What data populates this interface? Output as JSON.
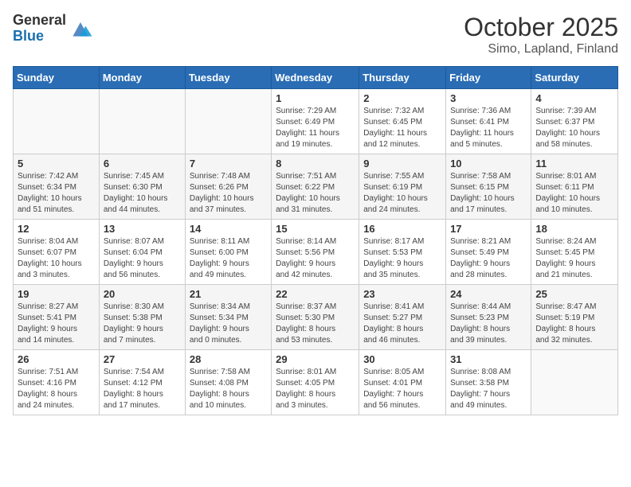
{
  "header": {
    "logo_general": "General",
    "logo_blue": "Blue",
    "month_title": "October 2025",
    "location": "Simo, Lapland, Finland"
  },
  "days_of_week": [
    "Sunday",
    "Monday",
    "Tuesday",
    "Wednesday",
    "Thursday",
    "Friday",
    "Saturday"
  ],
  "weeks": [
    [
      {
        "day": "",
        "info": ""
      },
      {
        "day": "",
        "info": ""
      },
      {
        "day": "",
        "info": ""
      },
      {
        "day": "1",
        "info": "Sunrise: 7:29 AM\nSunset: 6:49 PM\nDaylight: 11 hours\nand 19 minutes."
      },
      {
        "day": "2",
        "info": "Sunrise: 7:32 AM\nSunset: 6:45 PM\nDaylight: 11 hours\nand 12 minutes."
      },
      {
        "day": "3",
        "info": "Sunrise: 7:36 AM\nSunset: 6:41 PM\nDaylight: 11 hours\nand 5 minutes."
      },
      {
        "day": "4",
        "info": "Sunrise: 7:39 AM\nSunset: 6:37 PM\nDaylight: 10 hours\nand 58 minutes."
      }
    ],
    [
      {
        "day": "5",
        "info": "Sunrise: 7:42 AM\nSunset: 6:34 PM\nDaylight: 10 hours\nand 51 minutes."
      },
      {
        "day": "6",
        "info": "Sunrise: 7:45 AM\nSunset: 6:30 PM\nDaylight: 10 hours\nand 44 minutes."
      },
      {
        "day": "7",
        "info": "Sunrise: 7:48 AM\nSunset: 6:26 PM\nDaylight: 10 hours\nand 37 minutes."
      },
      {
        "day": "8",
        "info": "Sunrise: 7:51 AM\nSunset: 6:22 PM\nDaylight: 10 hours\nand 31 minutes."
      },
      {
        "day": "9",
        "info": "Sunrise: 7:55 AM\nSunset: 6:19 PM\nDaylight: 10 hours\nand 24 minutes."
      },
      {
        "day": "10",
        "info": "Sunrise: 7:58 AM\nSunset: 6:15 PM\nDaylight: 10 hours\nand 17 minutes."
      },
      {
        "day": "11",
        "info": "Sunrise: 8:01 AM\nSunset: 6:11 PM\nDaylight: 10 hours\nand 10 minutes."
      }
    ],
    [
      {
        "day": "12",
        "info": "Sunrise: 8:04 AM\nSunset: 6:07 PM\nDaylight: 10 hours\nand 3 minutes."
      },
      {
        "day": "13",
        "info": "Sunrise: 8:07 AM\nSunset: 6:04 PM\nDaylight: 9 hours\nand 56 minutes."
      },
      {
        "day": "14",
        "info": "Sunrise: 8:11 AM\nSunset: 6:00 PM\nDaylight: 9 hours\nand 49 minutes."
      },
      {
        "day": "15",
        "info": "Sunrise: 8:14 AM\nSunset: 5:56 PM\nDaylight: 9 hours\nand 42 minutes."
      },
      {
        "day": "16",
        "info": "Sunrise: 8:17 AM\nSunset: 5:53 PM\nDaylight: 9 hours\nand 35 minutes."
      },
      {
        "day": "17",
        "info": "Sunrise: 8:21 AM\nSunset: 5:49 PM\nDaylight: 9 hours\nand 28 minutes."
      },
      {
        "day": "18",
        "info": "Sunrise: 8:24 AM\nSunset: 5:45 PM\nDaylight: 9 hours\nand 21 minutes."
      }
    ],
    [
      {
        "day": "19",
        "info": "Sunrise: 8:27 AM\nSunset: 5:41 PM\nDaylight: 9 hours\nand 14 minutes."
      },
      {
        "day": "20",
        "info": "Sunrise: 8:30 AM\nSunset: 5:38 PM\nDaylight: 9 hours\nand 7 minutes."
      },
      {
        "day": "21",
        "info": "Sunrise: 8:34 AM\nSunset: 5:34 PM\nDaylight: 9 hours\nand 0 minutes."
      },
      {
        "day": "22",
        "info": "Sunrise: 8:37 AM\nSunset: 5:30 PM\nDaylight: 8 hours\nand 53 minutes."
      },
      {
        "day": "23",
        "info": "Sunrise: 8:41 AM\nSunset: 5:27 PM\nDaylight: 8 hours\nand 46 minutes."
      },
      {
        "day": "24",
        "info": "Sunrise: 8:44 AM\nSunset: 5:23 PM\nDaylight: 8 hours\nand 39 minutes."
      },
      {
        "day": "25",
        "info": "Sunrise: 8:47 AM\nSunset: 5:19 PM\nDaylight: 8 hours\nand 32 minutes."
      }
    ],
    [
      {
        "day": "26",
        "info": "Sunrise: 7:51 AM\nSunset: 4:16 PM\nDaylight: 8 hours\nand 24 minutes."
      },
      {
        "day": "27",
        "info": "Sunrise: 7:54 AM\nSunset: 4:12 PM\nDaylight: 8 hours\nand 17 minutes."
      },
      {
        "day": "28",
        "info": "Sunrise: 7:58 AM\nSunset: 4:08 PM\nDaylight: 8 hours\nand 10 minutes."
      },
      {
        "day": "29",
        "info": "Sunrise: 8:01 AM\nSunset: 4:05 PM\nDaylight: 8 hours\nand 3 minutes."
      },
      {
        "day": "30",
        "info": "Sunrise: 8:05 AM\nSunset: 4:01 PM\nDaylight: 7 hours\nand 56 minutes."
      },
      {
        "day": "31",
        "info": "Sunrise: 8:08 AM\nSunset: 3:58 PM\nDaylight: 7 hours\nand 49 minutes."
      },
      {
        "day": "",
        "info": ""
      }
    ]
  ]
}
